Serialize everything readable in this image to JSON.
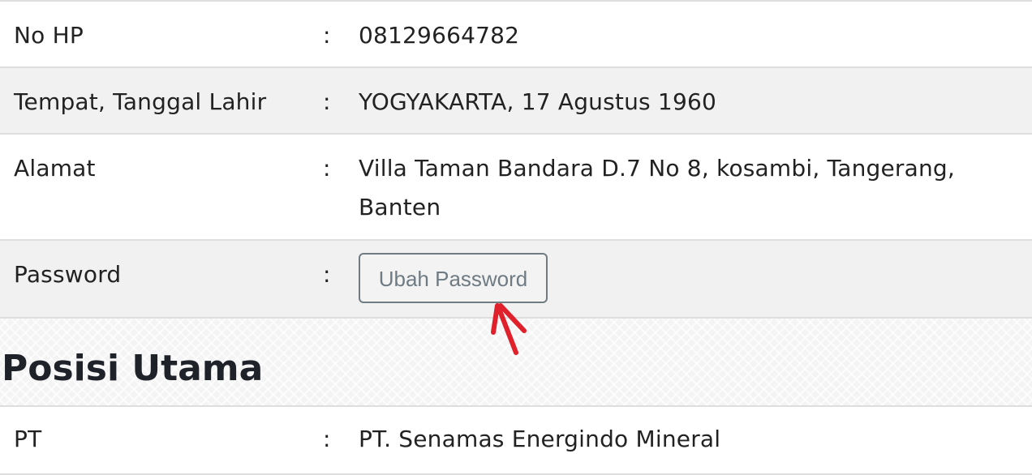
{
  "profile_rows": [
    {
      "label": "No HP",
      "separator": ":",
      "value": "08129664782"
    },
    {
      "label": "Tempat, Tanggal Lahir",
      "separator": ":",
      "value": "YOGYAKARTA, 17 Agustus 1960"
    },
    {
      "label": "Alamat",
      "separator": ":",
      "value_line1": "Villa Taman Bandara D.7 No 8, kosambi, Tangerang,",
      "value_line2": "Banten"
    },
    {
      "label": "Password",
      "separator": ":",
      "button_label": "Ubah Password"
    }
  ],
  "section": {
    "title": "Posisi Utama"
  },
  "position_rows": [
    {
      "label": "PT",
      "separator": ":",
      "value": "PT. Senamas Energindo Mineral"
    }
  ],
  "colors": {
    "row_alt": "#f1f1f1",
    "divider": "#dedede",
    "button_border": "#707b82",
    "annotation_arrow": "#e0202a"
  },
  "icons": {
    "annotation": "red-arrow-icon"
  }
}
